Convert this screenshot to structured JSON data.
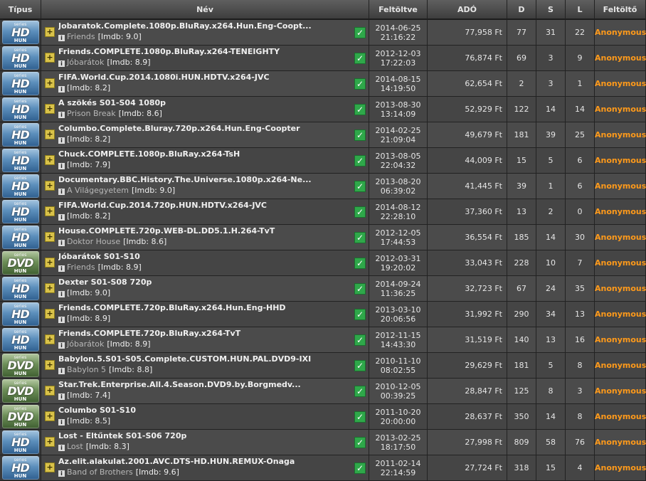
{
  "headers": [
    "Típus",
    "Név",
    "Feltöltve",
    "ADÓ",
    "D",
    "S",
    "L",
    "Feltöltő"
  ],
  "badge": {
    "series": "series",
    "hd": "HD",
    "dvd": "DVD",
    "hun": "HUN"
  },
  "info_glyph": "i",
  "plus_glyph": "+",
  "check_glyph": "✓",
  "rows": [
    {
      "type": "hd",
      "title": "Jobaratok.Complete.1080p.BluRay.x264.Hun.Eng-Coopt...",
      "orig": "Friends",
      "imdb": "[Imdb: 9.0]",
      "date": "2014-06-25",
      "time": "21:16:22",
      "tax": "77,958 Ft",
      "d": "77",
      "s": "31",
      "l": "22",
      "uploader": "Anonymous"
    },
    {
      "type": "hd",
      "title": "Friends.COMPLETE.1080p.BluRay.x264-TENEIGHTY",
      "orig": "Jóbarátok",
      "imdb": "[Imdb: 8.9]",
      "date": "2012-12-03",
      "time": "17:22:03",
      "tax": "76,874 Ft",
      "d": "69",
      "s": "3",
      "l": "9",
      "uploader": "Anonymous"
    },
    {
      "type": "hd",
      "title": "FIFA.World.Cup.2014.1080i.HUN.HDTV.x264-JVC",
      "orig": "",
      "imdb": "[Imdb: 8.2]",
      "date": "2014-08-15",
      "time": "14:19:50",
      "tax": "62,654 Ft",
      "d": "2",
      "s": "3",
      "l": "1",
      "uploader": "Anonymous"
    },
    {
      "type": "hd",
      "title": "A szökés S01-S04 1080p",
      "orig": "Prison Break",
      "imdb": "[Imdb: 8.6]",
      "date": "2013-08-30",
      "time": "13:14:09",
      "tax": "52,929 Ft",
      "d": "122",
      "s": "14",
      "l": "14",
      "uploader": "Anonymous"
    },
    {
      "type": "hd",
      "title": "Columbo.Complete.Bluray.720p.x264.Hun.Eng-Coopter",
      "orig": "",
      "imdb": "[Imdb: 8.2]",
      "date": "2014-02-25",
      "time": "21:09:04",
      "tax": "49,679 Ft",
      "d": "181",
      "s": "39",
      "l": "25",
      "uploader": "Anonymous"
    },
    {
      "type": "hd",
      "title": "Chuck.COMPLETE.1080p.BluRay.x264-TsH",
      "orig": "",
      "imdb": "[Imdb: 7.9]",
      "date": "2013-08-05",
      "time": "22:04:32",
      "tax": "44,009 Ft",
      "d": "15",
      "s": "5",
      "l": "6",
      "uploader": "Anonymous"
    },
    {
      "type": "hd",
      "title": "Documentary.BBC.History.The.Universe.1080p.x264-Ne...",
      "orig": "A Világegyetem",
      "imdb": "[Imdb: 9.0]",
      "date": "2013-08-20",
      "time": "06:39:02",
      "tax": "41,445 Ft",
      "d": "39",
      "s": "1",
      "l": "6",
      "uploader": "Anonymous"
    },
    {
      "type": "hd",
      "title": "FIFA.World.Cup.2014.720p.HUN.HDTV.x264-JVC",
      "orig": "",
      "imdb": "[Imdb: 8.2]",
      "date": "2014-08-12",
      "time": "22:28:10",
      "tax": "37,360 Ft",
      "d": "13",
      "s": "2",
      "l": "0",
      "uploader": "Anonymous"
    },
    {
      "type": "hd",
      "title": "House.COMPLETE.720p.WEB-DL.DD5.1.H.264-TvT",
      "orig": "Doktor House",
      "imdb": "[Imdb: 8.6]",
      "date": "2012-12-05",
      "time": "17:44:53",
      "tax": "36,554 Ft",
      "d": "185",
      "s": "14",
      "l": "30",
      "uploader": "Anonymous"
    },
    {
      "type": "dvd",
      "title": "Jóbarátok S01-S10",
      "orig": "Friends",
      "imdb": "[Imdb: 8.9]",
      "date": "2012-03-31",
      "time": "19:20:02",
      "tax": "33,043 Ft",
      "d": "228",
      "s": "10",
      "l": "7",
      "uploader": "Anonymous"
    },
    {
      "type": "hd",
      "title": "Dexter S01-S08 720p",
      "orig": "",
      "imdb": "[Imdb: 9.0]",
      "date": "2014-09-24",
      "time": "11:36:25",
      "tax": "32,723 Ft",
      "d": "67",
      "s": "24",
      "l": "35",
      "uploader": "Anonymous"
    },
    {
      "type": "hd",
      "title": "Friends.COMPLETE.720p.BluRay.x264.Hun.Eng-HHD",
      "orig": "",
      "imdb": "[Imdb: 8.9]",
      "date": "2013-03-10",
      "time": "20:06:56",
      "tax": "31,992 Ft",
      "d": "290",
      "s": "34",
      "l": "13",
      "uploader": "Anonymous"
    },
    {
      "type": "hd",
      "title": "Friends.COMPLETE.720p.BluRay.x264-TvT",
      "orig": "Jóbarátok",
      "imdb": "[Imdb: 8.9]",
      "date": "2012-11-15",
      "time": "14:43:30",
      "tax": "31,519 Ft",
      "d": "140",
      "s": "13",
      "l": "16",
      "uploader": "Anonymous"
    },
    {
      "type": "dvd",
      "title": "Babylon.5.S01-S05.Complete.CUSTOM.HUN.PAL.DVD9-IXI",
      "orig": "Babylon 5",
      "imdb": "[Imdb: 8.8]",
      "date": "2010-11-10",
      "time": "08:02:55",
      "tax": "29,629 Ft",
      "d": "181",
      "s": "5",
      "l": "8",
      "uploader": "Anonymous"
    },
    {
      "type": "dvd",
      "title": "Star.Trek.Enterprise.All.4.Season.DVD9.by.Borgmedv...",
      "orig": "",
      "imdb": "[Imdb: 7.4]",
      "date": "2010-12-05",
      "time": "00:39:25",
      "tax": "28,847 Ft",
      "d": "125",
      "s": "8",
      "l": "3",
      "uploader": "Anonymous"
    },
    {
      "type": "dvd",
      "title": "Columbo S01-S10",
      "orig": "",
      "imdb": "[Imdb: 8.5]",
      "date": "2011-10-20",
      "time": "20:00:00",
      "tax": "28,637 Ft",
      "d": "350",
      "s": "14",
      "l": "8",
      "uploader": "Anonymous"
    },
    {
      "type": "hd",
      "title": "Lost - Eltűntek S01-S06 720p",
      "orig": "Lost",
      "imdb": "[Imdb: 8.3]",
      "date": "2013-02-25",
      "time": "18:17:50",
      "tax": "27,998 Ft",
      "d": "809",
      "s": "58",
      "l": "76",
      "uploader": "Anonymous"
    },
    {
      "type": "hd",
      "title": "Az.elit.alakulat.2001.AVC.DTS-HD.HUN.REMUX-Onaga",
      "orig": "Band of Brothers",
      "imdb": "[Imdb: 9.6]",
      "date": "2011-02-14",
      "time": "22:14:59",
      "tax": "27,724 Ft",
      "d": "318",
      "s": "15",
      "l": "4",
      "uploader": "Anonymous"
    }
  ]
}
